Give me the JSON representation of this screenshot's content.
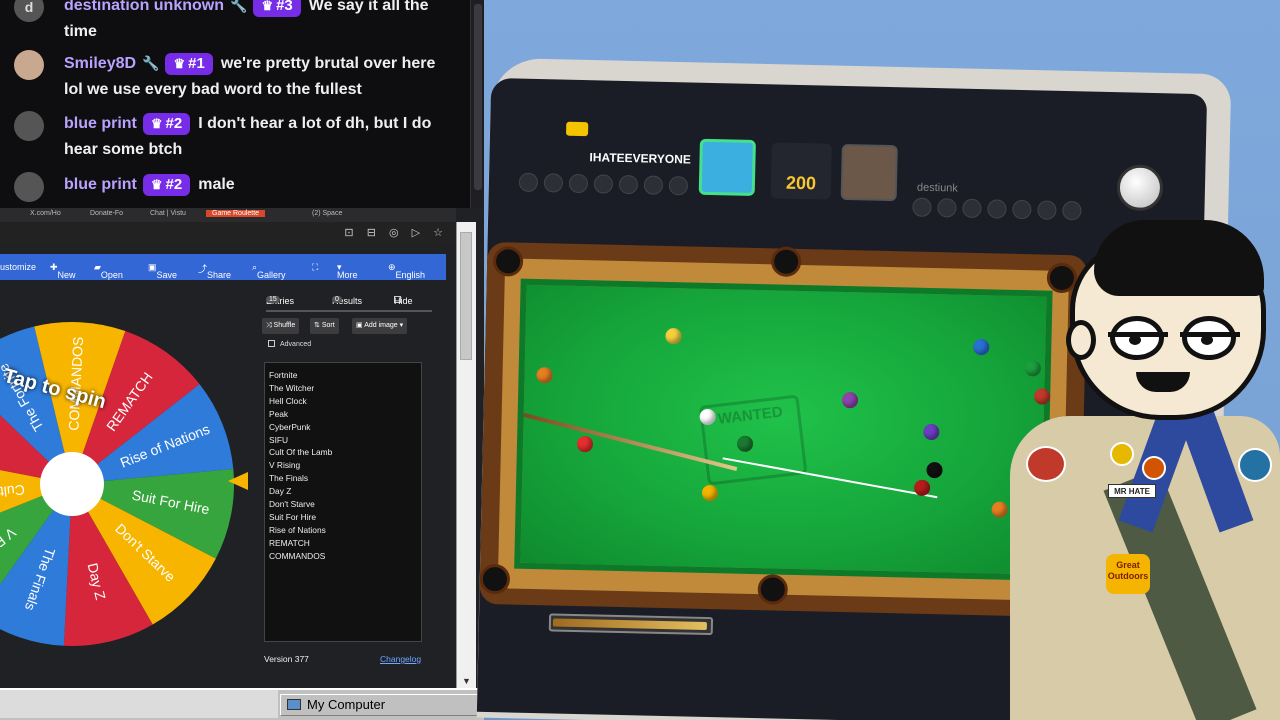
{
  "chat": {
    "messages": [
      {
        "avatar": "d",
        "user": "destination unknown",
        "has_wrench": true,
        "badge": "#3",
        "text": "We say it all the time"
      },
      {
        "avatar": "",
        "user": "Smiley8D",
        "has_wrench": true,
        "badge": "#1",
        "text": "we're pretty brutal over here lol we use every bad word to the fullest"
      },
      {
        "avatar": "",
        "user": "blue print",
        "has_wrench": false,
        "badge": "#2",
        "text": "I don't hear a lot of dh, but I do hear some btch"
      },
      {
        "avatar": "",
        "user": "blue print",
        "has_wrench": false,
        "badge": "#2",
        "text": "male"
      }
    ],
    "colors": {
      "username": "#b9a3ff",
      "badge_bg": "#772ce8"
    }
  },
  "browser": {
    "tabs": [
      "X.com/Ho",
      "Donate-Fo",
      "Chat | Vistu",
      "Game Roulette",
      "(2) Space"
    ]
  },
  "toolbar": {
    "items": [
      "ustomize",
      "New",
      "Open",
      "Save",
      "Share",
      "Gallery",
      "More",
      "English"
    ],
    "color": "#3367d6"
  },
  "wheel": {
    "tap_label": "Tap to spin",
    "segment_labels": [
      "COMMANDOS",
      "REMATCH",
      "Rise of Nations",
      "Suit For Hire",
      "Don't Starve",
      "Day Z",
      "The Finals",
      "V Rising",
      "Cult Of the Lamb",
      "SIFU",
      "The Fortnite"
    ],
    "segment_colors": [
      "#f7b500",
      "#d6263c",
      "#2f7bd9",
      "#37a53d"
    ]
  },
  "panel": {
    "entries_tab": "Entries",
    "entries_count": "15",
    "results_tab": "Results",
    "results_count": "0",
    "hide_label": "Hide",
    "shuffle_label": "Shuffle",
    "sort_label": "Sort",
    "add_image_label": "Add image",
    "advanced_label": "Advanced",
    "entries": [
      "Fortnite",
      "The Witcher",
      "Hell Clock",
      "Peak",
      "CyberPunk",
      "SIFU",
      "Cult Of the Lamb",
      "V Rising",
      "The Finals",
      "Day Z",
      "Don't Starve",
      "Suit For Hire",
      "Rise of Nations",
      "REMATCH",
      "COMMANDOS"
    ],
    "version": "Version 377",
    "changelog": "Changelog"
  },
  "taskbar": {
    "my_computer": "My Computer"
  },
  "game": {
    "player1": "IHATEEVERYONE",
    "player2": "destiunk",
    "stake": "200",
    "badge": "WANTED"
  },
  "cartoon": {
    "name_tag": "MR HATE",
    "badge_text": "Great Outdoors"
  }
}
